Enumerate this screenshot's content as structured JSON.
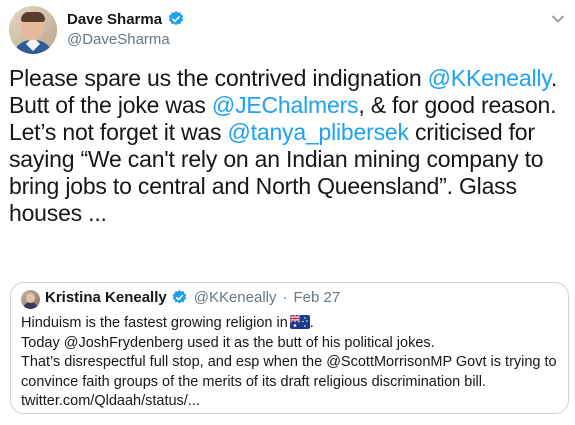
{
  "author": {
    "display_name": "Dave Sharma",
    "handle": "@DaveSharma",
    "verified_icon": "verified-badge-icon",
    "avatar_icon": "avatar-photo"
  },
  "menu_icon": "chevron-down-icon",
  "tweet": {
    "t1": "Please spare us the contrived indignation ",
    "m1": "@KKeneally",
    "t2": ". Butt of the joke was ",
    "m2": "@JEChalmers",
    "t3": ", & for good reason. Let’s not forget it was ",
    "m3": "@tanya_plibersek",
    "t4": " criticised for saying “We can't rely on an Indian mining company to bring jobs to central and North Queensland”. Glass houses ..."
  },
  "quoted": {
    "display_name": "Kristina Keneally",
    "handle": "@KKeneally",
    "separator": "·",
    "date": "Feb 27",
    "line1": "Hinduism is the fastest growing religion in",
    "line1_end": ".",
    "line2": "Today @JoshFrydenberg used it as the butt of his political jokes.",
    "line3": "That’s disrespectful full stop, and esp when the @ScottMorrisonMP Govt is trying to convince faith groups of the merits of its draft religious discrimination bill. twitter.com/Qldaah/status/...",
    "flag_icon": "australia-flag-icon"
  },
  "colors": {
    "link": "#1da1f2",
    "secondary_text": "#657786",
    "border": "#ccd6dd",
    "verified": "#1da1f2"
  }
}
